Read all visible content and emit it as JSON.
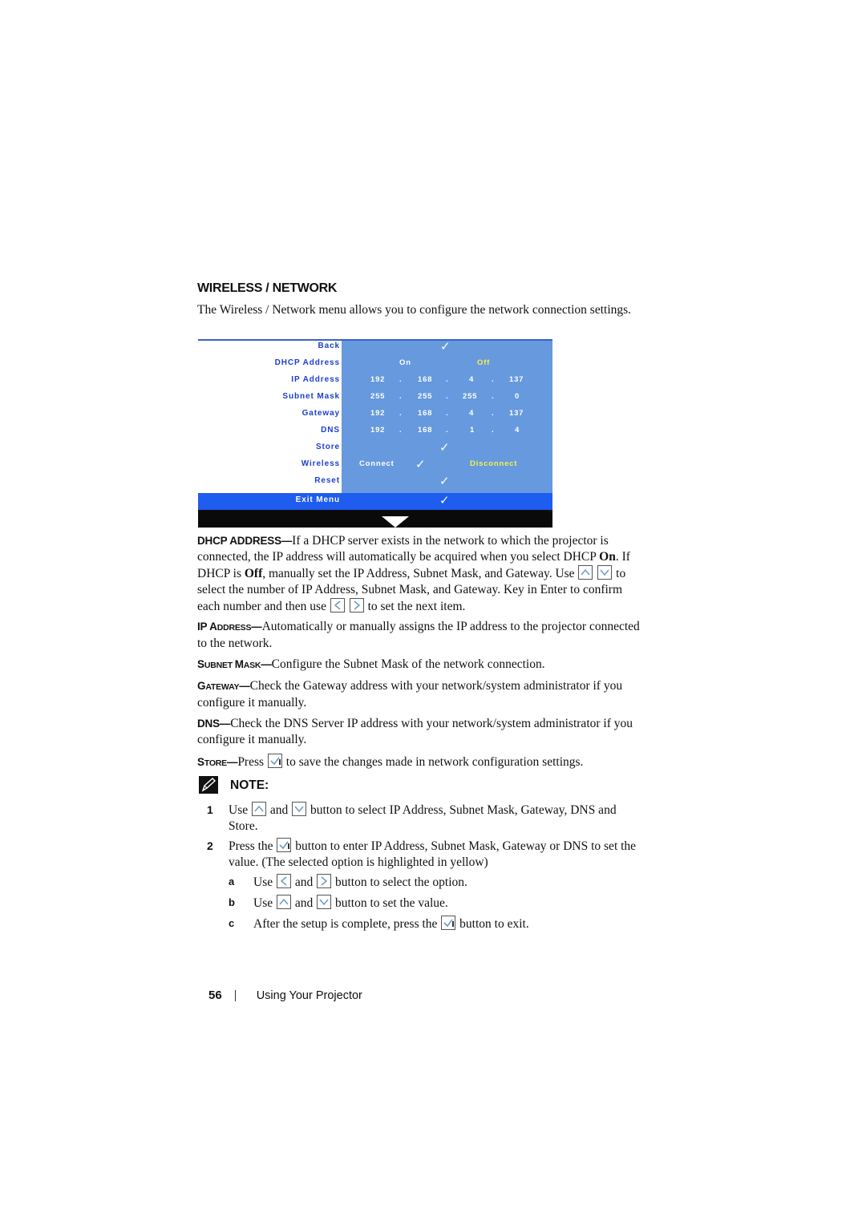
{
  "section": {
    "title": "WIRELESS / NETWORK",
    "intro": "The Wireless / Network menu allows you to configure the network connection settings."
  },
  "osd_menu": {
    "colors": {
      "panel": "#6799de",
      "label": "#1b3fd0",
      "selected_value": "#f3f34a",
      "exit_row": "#1f5cf0",
      "footer": "#0a0a0a"
    },
    "rows": [
      {
        "label": "Back",
        "check": "✓"
      },
      {
        "label": "DHCP Address",
        "options": [
          "On",
          "Off"
        ],
        "selected": "Off"
      },
      {
        "label": "IP Address",
        "octets": [
          "192",
          "168",
          "4",
          "137"
        ]
      },
      {
        "label": "Subnet Mask",
        "octets": [
          "255",
          "255",
          "255",
          "0"
        ]
      },
      {
        "label": "Gateway",
        "octets": [
          "192",
          "168",
          "4",
          "137"
        ]
      },
      {
        "label": "DNS",
        "octets": [
          "192",
          "168",
          "1",
          "4"
        ]
      },
      {
        "label": "Store",
        "check": "✓"
      },
      {
        "label": "Wireless",
        "options": [
          "Connect",
          "Disconnect"
        ],
        "check": "✓",
        "selected": "Disconnect"
      },
      {
        "label": "Reset",
        "check": "✓"
      },
      {
        "label": "Exit Menu",
        "check": "✓"
      }
    ],
    "dot": "."
  },
  "descriptions": {
    "dhcp": {
      "term": "DHCP ADDRESS—",
      "t1": "If a DHCP server exists in the network to which the projector is connected, the IP address will automatically be acquired when you select DHCP ",
      "on": "On",
      "t2": ". If DHCP is ",
      "off": "Off",
      "t3": ", manually set the IP Address, Subnet Mask, and Gateway. Use ",
      "t4": " to select the number of IP Address, Subnet Mask, and Gateway. Key in Enter to confirm each number and then use ",
      "t5": " to set the next item."
    },
    "ip": {
      "term_a": "IP A",
      "term_b": "DDRESS",
      "term_c": "—",
      "text": "Automatically or manually assigns the IP address to the projector connected to the network."
    },
    "subnet": {
      "term_a": "S",
      "term_b": "UBNET ",
      "term_c": "M",
      "term_d": "ASK",
      "term_e": "—",
      "text": "Configure the Subnet Mask of the network connection."
    },
    "gateway": {
      "term_a": "G",
      "term_b": "ATEWAY",
      "term_c": "—",
      "text": "Check the Gateway address with your network/system administrator if you configure it manually."
    },
    "dns": {
      "term": "DNS—",
      "text": "Check the DNS Server IP address with your network/system administrator if you configure it manually."
    },
    "store": {
      "term_a": "S",
      "term_b": "TORE",
      "term_c": "—",
      "t1": "Press ",
      "t2": " to save the changes made in network configuration settings."
    }
  },
  "note": {
    "label": "NOTE:",
    "items": [
      {
        "num": "1",
        "t1": "Use ",
        "t2": " and ",
        "t3": " button to select IP Address, Subnet Mask, Gateway, DNS and Store."
      },
      {
        "num": "2",
        "t1": "Press the ",
        "t2": " button to enter IP Address, Subnet Mask, Gateway or DNS to set the value. (The selected option is highlighted in yellow)"
      }
    ],
    "subitems": [
      {
        "letter": "a",
        "t1": "Use ",
        "t2": " and ",
        "t3": " button to select the option."
      },
      {
        "letter": "b",
        "t1": "Use ",
        "t2": " and ",
        "t3": " button to set the value."
      },
      {
        "letter": "c",
        "t1": "After the setup is complete, press the ",
        "t2": " button to exit."
      }
    ]
  },
  "footer": {
    "page_number": "56",
    "chapter": "Using Your Projector"
  }
}
